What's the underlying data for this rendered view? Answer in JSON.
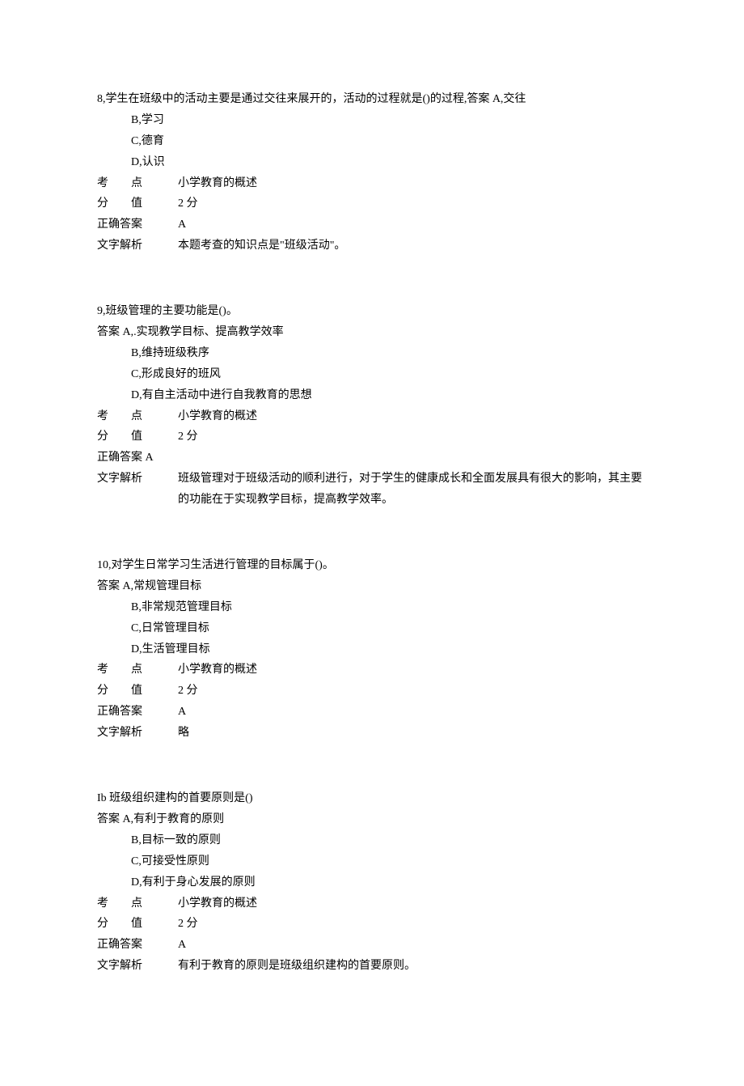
{
  "questions": [
    {
      "num": "8",
      "stem": "学生在班级中的活动主要是通过交往来展开的，活动的过程就是()的过程,答案 A,交往",
      "options": [
        "B,学习",
        "C,德育",
        "D,认识"
      ],
      "kaodian_label": "考　　点",
      "kaodian_value": "小学教育的概述",
      "fenzhi_label": "分　　值",
      "fenzhi_value": "2 分",
      "answer_label": "正确答案",
      "answer_value": "A",
      "jiexi_label": "文字解析",
      "jiexi_value": "本题考查的知识点是\"班级活动\"。"
    },
    {
      "num": "9",
      "stem": "班级管理的主要功能是()。",
      "first_option": "答案 A,.实现教学目标、提高教学效率",
      "options": [
        "B,维持班级秩序",
        "C,形成良好的班风",
        "D,有自主活动中进行自我教育的思想"
      ],
      "kaodian_label": "考　　点",
      "kaodian_value": "小学教育的概述",
      "fenzhi_label": "分　　值",
      "fenzhi_value": "2 分",
      "answer_label": "正确答案 A",
      "answer_value": "",
      "jiexi_label": "文字解析",
      "jiexi_value": "班级管理对于班级活动的顺利进行，对于学生的健康成长和全面发展具有很大的影响，其主要的功能在于实现教学目标，提高教学效率。"
    },
    {
      "num": "10",
      "stem": "对学生日常学习生活进行管理的目标属于()。",
      "first_option": "答案 A,常规管理目标",
      "options": [
        "B,非常规范管理目标",
        "C,日常管理目标",
        "D,生活管理目标"
      ],
      "kaodian_label": "考　　点",
      "kaodian_value": "小学教育的概述",
      "fenzhi_label": "分　　值",
      "fenzhi_value": "2 分",
      "answer_label": "正确答案",
      "answer_value": "A",
      "jiexi_label": "文字解析",
      "jiexi_value": "略"
    },
    {
      "num": "Ib",
      "stem": "班级组织建构的首要原则是()",
      "first_option": "答案 A,有利于教育的原则",
      "options": [
        "B,目标一致的原则",
        "C,可接受性原则",
        "D,有利于身心发展的原则"
      ],
      "kaodian_label": "考　　点",
      "kaodian_value": "小学教育的概述",
      "fenzhi_label": "分　　值",
      "fenzhi_value": "2 分",
      "answer_label": "正确答案",
      "answer_value": "A",
      "jiexi_label": "文字解析",
      "jiexi_value": "有利于教育的原则是班级组织建构的首要原则。"
    }
  ]
}
